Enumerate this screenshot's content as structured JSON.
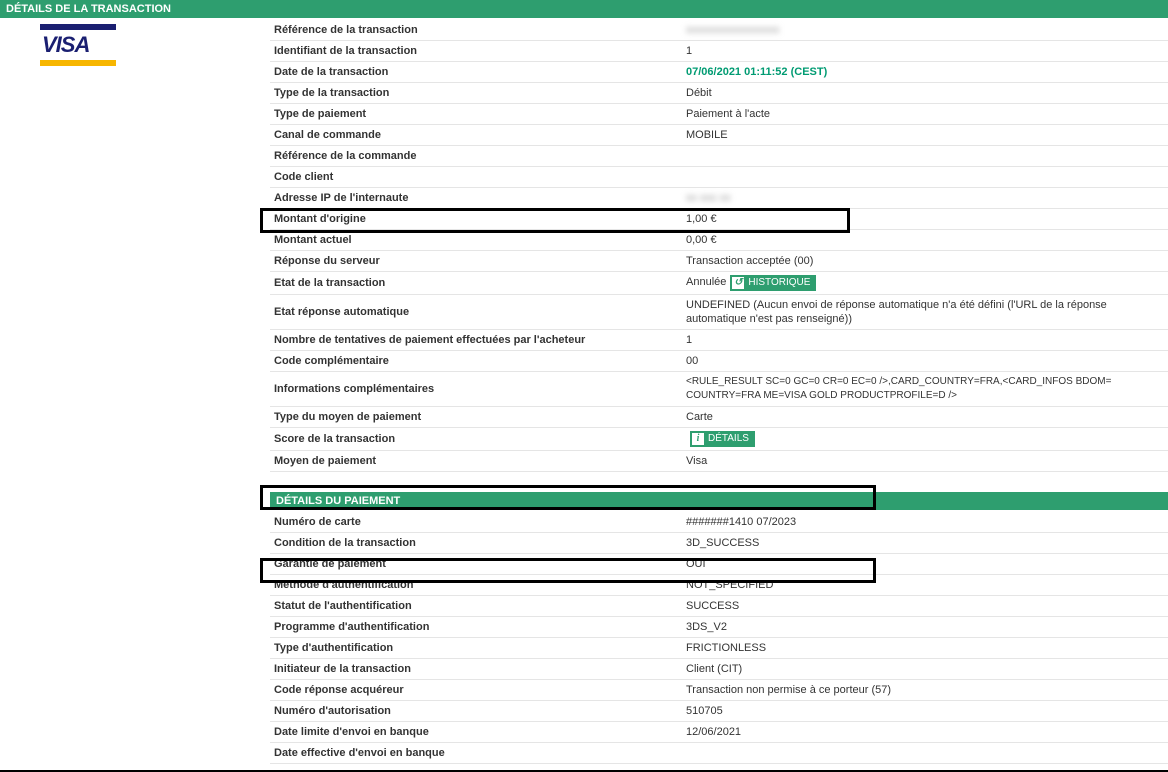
{
  "section1_title": "DÉTAILS DE LA TRANSACTION",
  "logo_text": "VISA",
  "tx": {
    "ref_label": "Référence de la transaction",
    "ref_value": "",
    "id_label": "Identifiant de la transaction",
    "id_value": "1",
    "date_label": "Date de la transaction",
    "date_value": "07/06/2021 01:11:52 (CEST)",
    "type_label": "Type de la transaction",
    "type_value": "Débit",
    "paytype_label": "Type de paiement",
    "paytype_value": "Paiement à l'acte",
    "channel_label": "Canal de commande",
    "channel_value": "MOBILE",
    "orderref_label": "Référence de la commande",
    "orderref_value": "",
    "clientcode_label": "Code client",
    "clientcode_value": "",
    "ip_label": "Adresse IP de l'internaute",
    "ip_value": "",
    "origamt_label": "Montant d'origine",
    "origamt_value": "1,00 €",
    "curamt_label": "Montant actuel",
    "curamt_value": "0,00 €",
    "resp_label": "Réponse du serveur",
    "resp_value": "Transaction acceptée (00)",
    "state_label": "Etat de la transaction",
    "state_value": "Annulée",
    "state_badge": "HISTORIQUE",
    "autoresp_label": "Etat réponse automatique",
    "autoresp_value": "UNDEFINED (Aucun envoi de réponse automatique n'a été défini (l'URL de la réponse automatique n'est pas renseigné))",
    "attempts_label": "Nombre de tentatives de paiement effectuées par l'acheteur",
    "attempts_value": "1",
    "compcode_label": "Code complémentaire",
    "compcode_value": "00",
    "info_label": "Informations complémentaires",
    "info_value": "<RULE_RESULT SC=0 GC=0 CR=0 EC=0 />,CARD_COUNTRY=FRA,<CARD_INFOS BDOM=                     COUNTRY=FRA ME=VISA GOLD PRODUCTPROFILE=D />",
    "meanstype_label": "Type du moyen de paiement",
    "meanstype_value": "Carte",
    "score_label": "Score de la transaction",
    "score_value": "",
    "score_badge": "DÉTAILS",
    "means_label": "Moyen de paiement",
    "means_value": "Visa"
  },
  "section2_title": "DÉTAILS DU PAIEMENT",
  "pm": {
    "card_label": "Numéro de carte",
    "card_value": "#######1410  07/2023",
    "cond_label": "Condition de la transaction",
    "cond_value": "3D_SUCCESS",
    "guar_label": "Garantie de paiement",
    "guar_value": "OUI",
    "authm_label": "Méthode d'authentification",
    "authm_value": "NOT_SPECIFIED",
    "auths_label": "Statut de l'authentification",
    "auths_value": "SUCCESS",
    "prog_label": "Programme d'authentification",
    "prog_value": "3DS_V2",
    "autht_label": "Type d'authentification",
    "autht_value": "FRICTIONLESS",
    "init_label": "Initiateur de la transaction",
    "init_value": "Client (CIT)",
    "acq_label": "Code réponse acquéreur",
    "acq_value": "Transaction non permise à ce porteur (57)",
    "authnum_label": "Numéro d'autorisation",
    "authnum_value": "510705",
    "limit_label": "Date limite d'envoi en banque",
    "limit_value": "12/06/2021",
    "eff_label": "Date effective d'envoi en banque",
    "eff_value": ""
  }
}
